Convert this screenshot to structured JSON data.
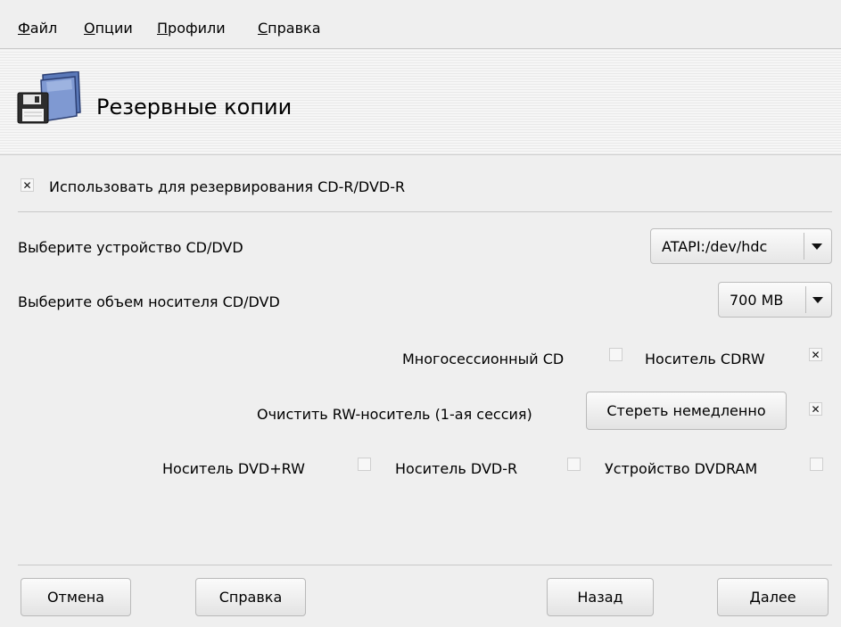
{
  "menu": {
    "file": "Файл",
    "options": "Опции",
    "profiles": "Профили",
    "help": "Справка"
  },
  "header": {
    "title": "Резервные копии",
    "icon": "folder-floppy-icon"
  },
  "use_cd": {
    "label": "Использовать для резервирования CD-R/DVD-R",
    "checked": true
  },
  "device": {
    "label": "Выберите устройство CD/DVD",
    "value": "ATAPI:/dev/hdc"
  },
  "media_size": {
    "label": "Выберите объем носителя CD/DVD",
    "value": "700 MB"
  },
  "multisession": {
    "label": "Многосессионный CD",
    "checked": false
  },
  "cdrw": {
    "label": "Носитель CDRW",
    "checked": true
  },
  "erase_rw": {
    "label": "Очистить RW-носитель (1-ая сессия)",
    "button": "Стереть немедленно",
    "checked": true
  },
  "dvd_rw": {
    "label": "Носитель DVD+RW",
    "checked": false
  },
  "dvd_r": {
    "label": "Носитель DVD-R",
    "checked": false
  },
  "dvdram": {
    "label": "Устройство DVDRAM",
    "checked": false
  },
  "buttons": {
    "cancel": "Отмена",
    "help": "Справка",
    "back": "Назад",
    "next": "Далее"
  }
}
